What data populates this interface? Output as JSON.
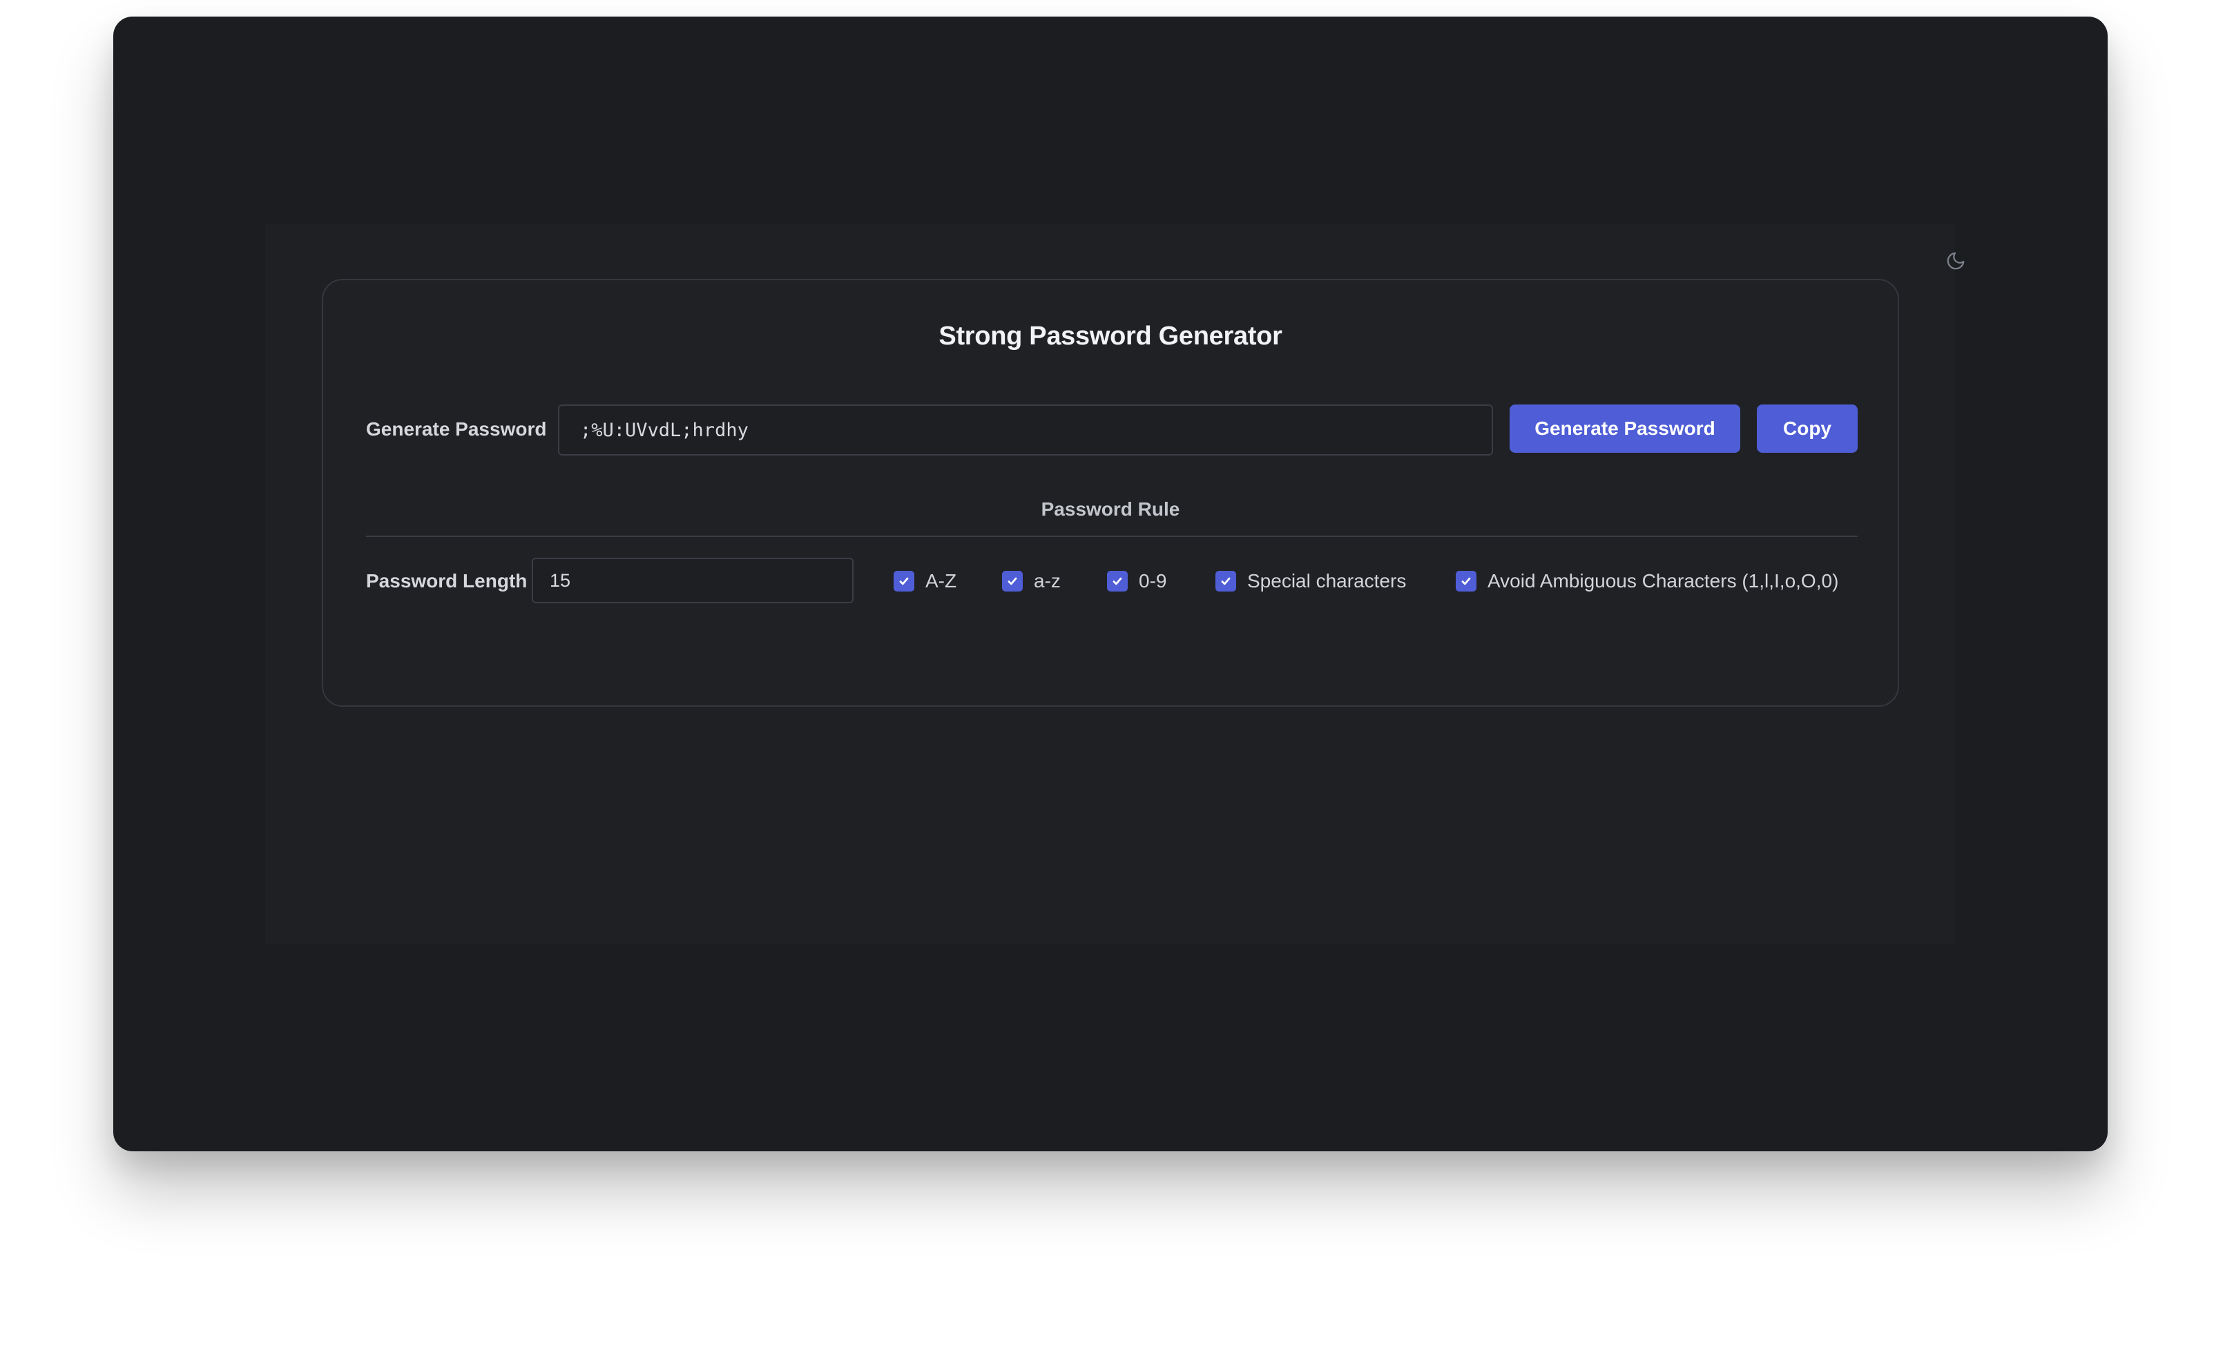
{
  "app": {
    "title": "Strong Password Generator",
    "theme_icon": "moon-icon"
  },
  "generator": {
    "label": "Generate Password",
    "password_value": ";%U:UVvdL;hrdhy",
    "generate_button_label": "Generate Password",
    "copy_button_label": "Copy"
  },
  "rules": {
    "heading": "Password Rule",
    "length_label": "Password Length",
    "length_value": "15",
    "options": [
      {
        "label": "A-Z",
        "checked": true
      },
      {
        "label": "a-z",
        "checked": true
      },
      {
        "label": "0-9",
        "checked": true
      },
      {
        "label": "Special characters",
        "checked": true
      },
      {
        "label": "Avoid Ambiguous Characters (1,l,I,o,O,0)",
        "checked": true
      }
    ]
  },
  "colors": {
    "accent": "#4f5ed6",
    "window_bg": "#1b1d21",
    "card_border": "#34373d"
  }
}
